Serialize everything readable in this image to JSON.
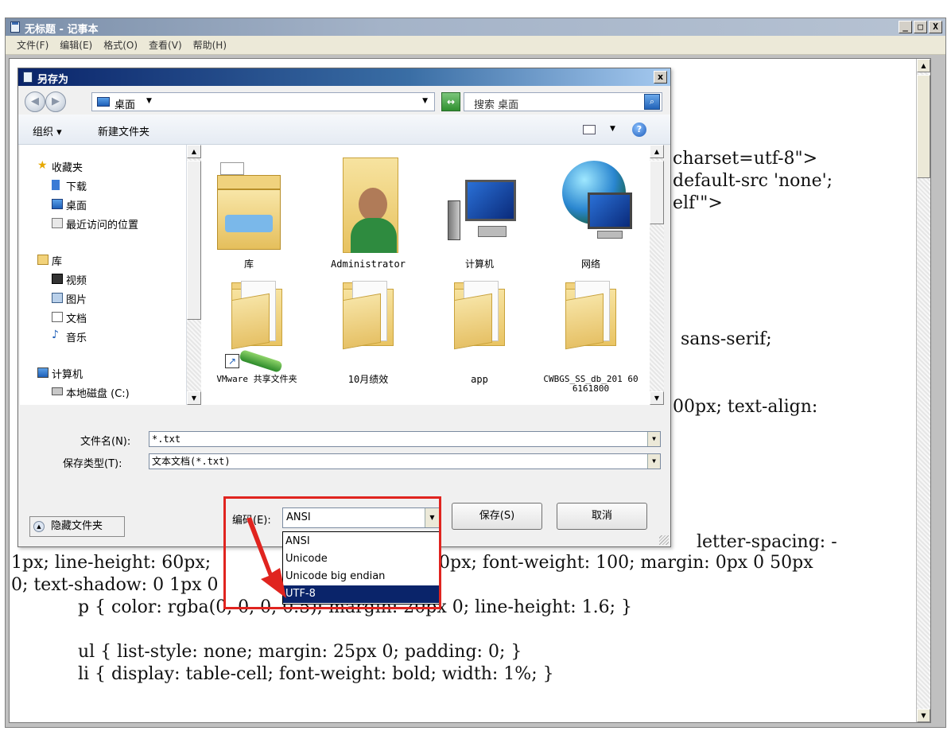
{
  "notepad": {
    "title": "无标题 - 记事本",
    "menu": [
      "文件(F)",
      "编辑(E)",
      "格式(O)",
      "查看(V)",
      "帮助(H)"
    ],
    "window_buttons": [
      "_",
      "□",
      "X"
    ],
    "lines": {
      "l1": "charset=utf-8\">",
      "l2": "default-src 'none';",
      "l3": "elf'\">",
      "l4": "sans-serif;",
      "l5": "00px; text-align:",
      "l6": "letter-spacing: -",
      "l7a": "1px; line-height: 60px;",
      "l7b": "0px; font-weight: 100; margin: 0px 0 50px",
      "l8a": "0; text-shadow: 0 1px 0",
      "l9": "    p { color: rgba(0, 0, 0, 0.5); margin: 20px 0; line-height: 1.6; }",
      "l10": "    ul { list-style: none; margin: 25px 0; padding: 0; }",
      "l11": "    li { display: table-cell; font-weight: bold; width: 1%; }"
    }
  },
  "dialog": {
    "title": "另存为",
    "close": "x",
    "address": "桌面",
    "search_placeholder": "搜索 桌面",
    "toolbar": {
      "organize": "组织 ▾",
      "new_folder": "新建文件夹"
    },
    "nav": {
      "favorites": "收藏夹",
      "downloads": "下载",
      "desktop": "桌面",
      "recent": "最近访问的位置",
      "libraries": "库",
      "videos": "视频",
      "pictures": "图片",
      "documents": "文档",
      "music": "音乐",
      "computer": "计算机",
      "local_disk": "本地磁盘 (C:)"
    },
    "files": [
      "库",
      "Administrator",
      "计算机",
      "网络",
      "VMware 共享文件夹",
      "10月绩效",
      "app",
      "CWBGS_SS_db_201 606161800"
    ],
    "filename_label": "文件名(N):",
    "filename_value": "*.txt",
    "filetype_label": "保存类型(T):",
    "filetype_value": "文本文档(*.txt)",
    "hide_folders": "隐藏文件夹",
    "encoding_label": "编码(E):",
    "encoding_value": "ANSI",
    "encoding_options": [
      "ANSI",
      "Unicode",
      "Unicode big endian",
      "UTF-8"
    ],
    "save": "保存(S)",
    "cancel": "取消"
  },
  "colors": {
    "highlight_frame": "#e0241f",
    "selection": "#0a246a"
  }
}
